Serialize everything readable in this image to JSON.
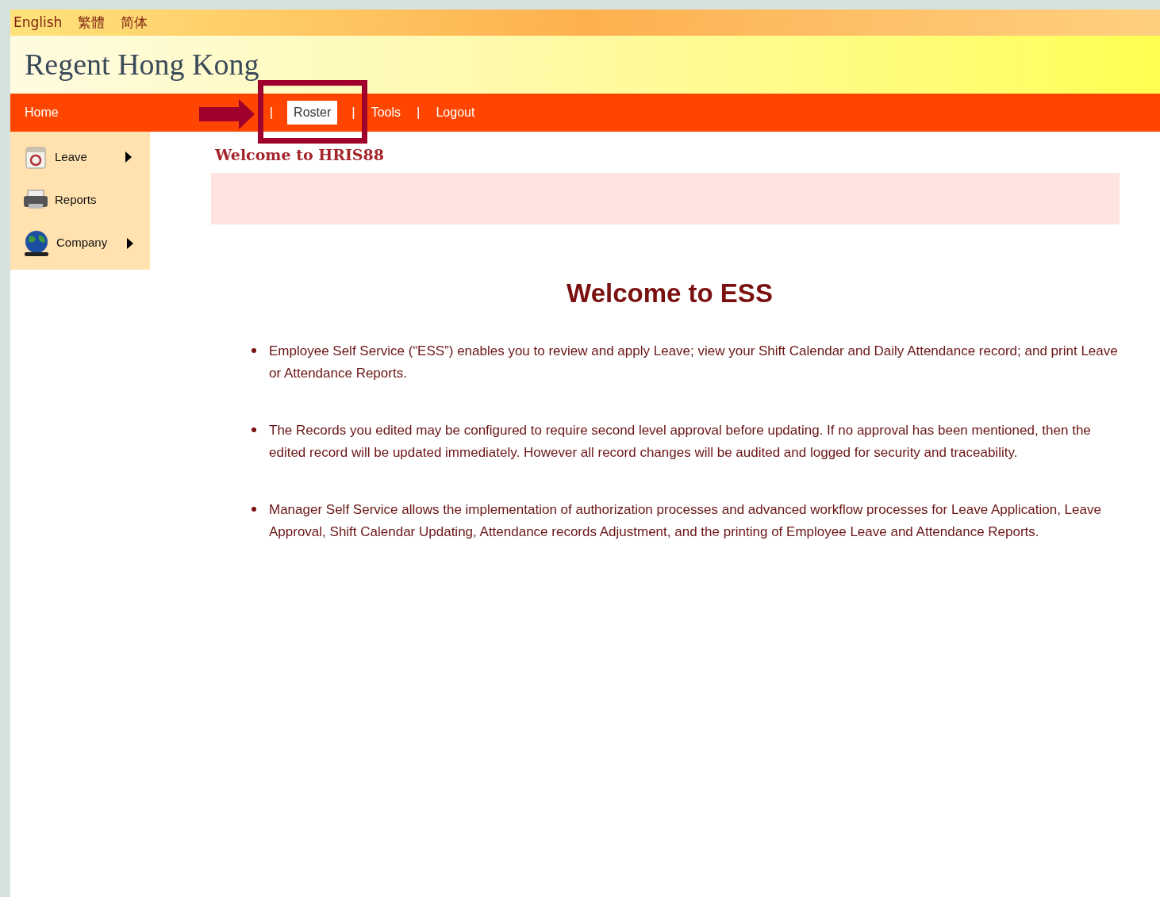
{
  "languages": [
    "English",
    "繁體",
    "简体"
  ],
  "site_title": "Regent Hong Kong",
  "nav": [
    {
      "kind": "link",
      "label": "Home",
      "selected": false
    },
    {
      "kind": "separator",
      "label": "|"
    },
    {
      "kind": "link",
      "label": "Roster",
      "selected": true
    },
    {
      "kind": "separator",
      "label": "|"
    },
    {
      "kind": "link",
      "label": "Tools",
      "selected": false
    },
    {
      "kind": "separator",
      "label": "|"
    },
    {
      "kind": "link",
      "label": "Logout",
      "selected": false
    }
  ],
  "sidebar": {
    "items": [
      {
        "kind": "calendar",
        "label": "Leave",
        "submenu": true
      },
      {
        "kind": "printer",
        "label": "Reports",
        "submenu": false
      },
      {
        "kind": "globe",
        "label": "Company",
        "submenu": true
      }
    ]
  },
  "page_heading": "Welcome to HRIS88",
  "title": "Welcome to ESS",
  "bullets": [
    "Employee Self Service (“ESS”) enables you to review and apply Leave; view your Shift Calendar and Daily Attendance record; and print Leave or Attendance Reports.",
    "The Records you edited may be configured to require second level approval before updating. If no approval has been mentioned, then the edited record will be updated immediately. However all record changes will be audited and logged for security and traceability.",
    "Manager Self Service allows the implementation of authorization processes and advanced workflow processes for Leave Application, Leave Approval, Shift Calendar Updating, Attendance records Adjustment, and the printing of Employee Leave and Attendance Reports."
  ]
}
